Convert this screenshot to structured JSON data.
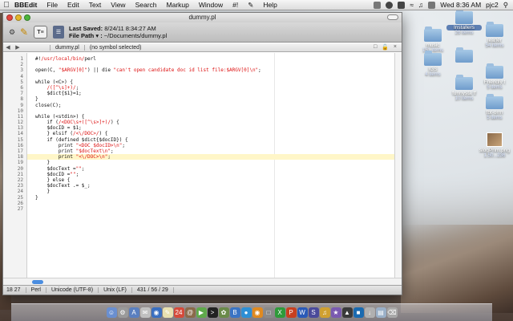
{
  "menubar": {
    "app_name": "BBEdit",
    "menus": [
      "File",
      "Edit",
      "Text",
      "View",
      "Search",
      "Markup",
      "Window",
      "#!",
      "Help"
    ],
    "clock": "Wed 8:36 AM",
    "user": "pjc2"
  },
  "window": {
    "title": "dummy.pl",
    "last_saved_label": "Last Saved:",
    "last_saved_value": "8/24/11 8:34:27 AM",
    "file_path_label": "File Path ▾ :",
    "file_path_value": "~/Documents/dummy.pl",
    "text_button_label": "T≡",
    "doc_popup": "dummy.pl",
    "symbol_popup": "(no symbol selected)"
  },
  "editor": {
    "line_numbers": [
      "1",
      "2",
      "3",
      "4",
      "5",
      "6",
      "7",
      "8",
      "9",
      "10",
      "11",
      "12",
      "13",
      "14",
      "15",
      "16",
      "17",
      "18",
      "19",
      "20",
      "21",
      "22",
      "23",
      "24",
      "25",
      "26",
      "27"
    ],
    "highlighted_line": 18,
    "lines": [
      "#!/usr/local/bin/perl",
      "",
      "open(C, \"$ARGV[0]\") || die \"can't open candidate doc id list file:$ARGV[0]\\n\";",
      "",
      "while (<C>) {",
      "    /([^\\s]+)/;",
      "    $dict{$1}=1;",
      "}",
      "close(C);",
      "",
      "while (<stdin>) {",
      "    if (/<DOC\\s+([^\\s>]+)/) {",
      "    $docID = $1;",
      "    } elsif (/<\\/DOC>/) {",
      "    if (defined $dict{$docID}) {",
      "        print \"<DOC $docID>\\n\";",
      "        print \"$docText\\n\";",
      "        print \"<\\/DOC>\\n\";",
      "    }",
      "    $docText =\"\";",
      "    $docID =\"\";",
      "    } else {",
      "    $docText .= $_;",
      "    }",
      "}",
      "",
      ""
    ]
  },
  "statusbar": {
    "position": "18  27",
    "language": "Perl",
    "encoding": "Unicode (UTF-8)",
    "line_endings": "Unix (LF)",
    "counts": "431 / 56 / 29"
  },
  "desktop_icons": [
    {
      "name": "music",
      "sub": "151 items"
    },
    {
      "name": "Installers",
      "sub": "26 items"
    },
    {
      "name": "leafler",
      "sub": "54 items"
    },
    {
      "name": "",
      "sub": ""
    },
    {
      "name": "IGS",
      "sub": "4 items"
    },
    {
      "name": "funnysta ff",
      "sub": "10 items"
    },
    {
      "name": "Friendly t",
      "sub": "5 items"
    },
    {
      "name": "fbt-orrn",
      "sub": "5 items"
    },
    {
      "name": "slogPrim.png",
      "sub": "1.50...236"
    }
  ],
  "colors": {
    "string": "#dd1111",
    "keyword": "#1d2e9e",
    "highlight": "#fff6c8"
  }
}
